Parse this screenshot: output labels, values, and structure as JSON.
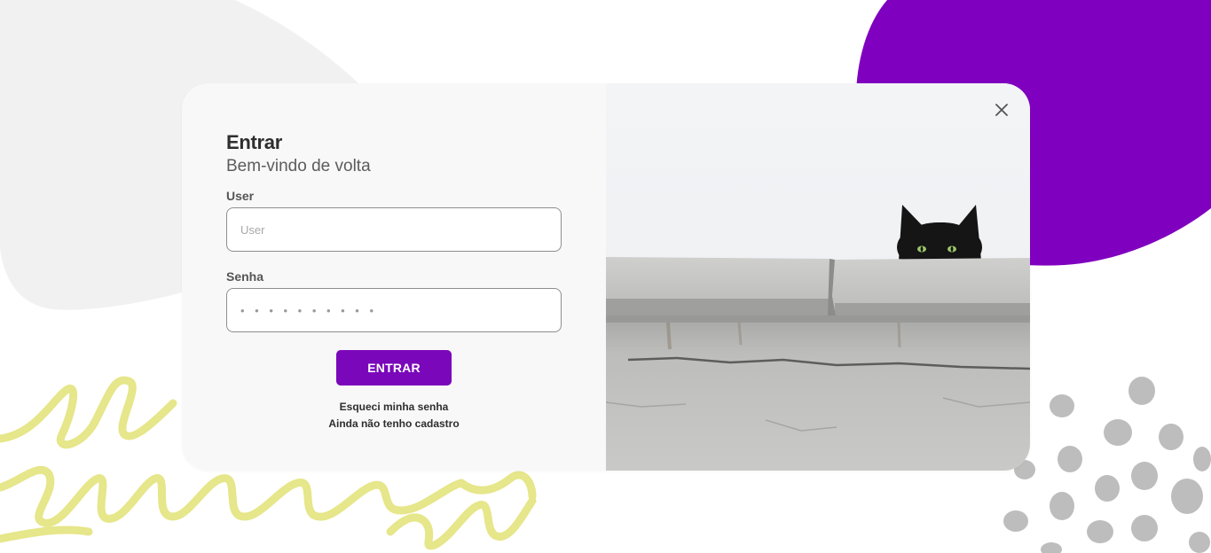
{
  "login": {
    "title": "Entrar",
    "subtitle": "Bem-vindo de volta",
    "user_label": "User",
    "user_placeholder": "User",
    "password_label": "Senha",
    "password_placeholder": "• • • • • • • • • •",
    "submit_label": "ENTRAR",
    "forgot_link": "Esqueci minha senha",
    "register_link": "Ainda não tenho cadastro"
  },
  "icons": {
    "close": "close-icon",
    "photo": "cat-on-wall-photo"
  },
  "colors": {
    "accent": "#7a07ba",
    "blob_purple": "#8000c0",
    "squiggle_yellow": "#e6e68a",
    "spots_gray": "#bdbdbd",
    "blob_gray": "#f1f1f1"
  }
}
